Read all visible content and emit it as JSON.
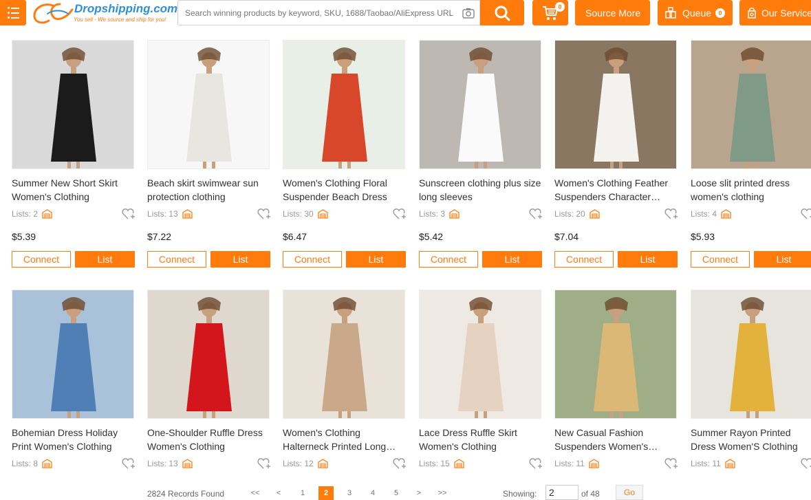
{
  "header": {
    "logo_title": "Dropshipping.com",
    "logo_tagline": "You sell - We source and ship for you!",
    "search_placeholder": "Search winning products by keyword, SKU, 1688/Taobao/AliExpress URL",
    "cart_count": "0",
    "source_more_label": "Source More",
    "queue_label": "Queue",
    "queue_count": "0",
    "our_service_label": "Our Service",
    "accent_color": "#ff7b0c"
  },
  "products": [
    {
      "title": "Summer New Short Skirt Women's Clothing",
      "lists": "Lists: 2",
      "price": "$5.39",
      "connect": "Connect",
      "list": "List",
      "img_bg": "#d9d9d9",
      "dress": "#1b1b1b"
    },
    {
      "title": "Beach skirt swimwear sun protection clothing",
      "lists": "Lists: 13",
      "price": "$7.22",
      "connect": "Connect",
      "list": "List",
      "img_bg": "#f7f7f7",
      "dress": "#e8e6e1"
    },
    {
      "title": "Women's Clothing Floral Suspender Beach Dress",
      "lists": "Lists: 30",
      "price": "$6.47",
      "connect": "Connect",
      "list": "List",
      "img_bg": "#e8efe6",
      "dress": "#d9472b"
    },
    {
      "title": "Sunscreen clothing plus size long sleeves",
      "lists": "Lists: 3",
      "price": "$5.42",
      "connect": "Connect",
      "list": "List",
      "img_bg": "#bdb8b1",
      "dress": "#fafafa"
    },
    {
      "title": "Women's Clothing Feather Suspenders Character Fashion Dress",
      "lists": "Lists: 20",
      "price": "$7.04",
      "connect": "Connect",
      "list": "List",
      "img_bg": "#8a7762",
      "dress": "#f4f2ee"
    },
    {
      "title": "Loose slit printed dress women's clothing",
      "lists": "Lists: 4",
      "price": "$5.93",
      "connect": "Connect",
      "list": "List",
      "img_bg": "#b9a58e",
      "dress": "#7f9a86"
    },
    {
      "title": "Bohemian Dress Holiday Print Women's Clothing",
      "lists": "Lists: 8",
      "price": "",
      "connect": "",
      "list": "",
      "img_bg": "#a9c2d9",
      "dress": "#4f7fb5"
    },
    {
      "title": "One-Shoulder Ruffle Dress Women's Clothing",
      "lists": "Lists: 13",
      "price": "",
      "connect": "",
      "list": "",
      "img_bg": "#dfd8cf",
      "dress": "#d3151c"
    },
    {
      "title": "Women's Clothing Halterneck Printed Long Dress",
      "lists": "Lists: 12",
      "price": "",
      "connect": "",
      "list": "",
      "img_bg": "#e9e2d8",
      "dress": "#c9a98a"
    },
    {
      "title": "Lace Dress Ruffle Skirt Women's Clothing",
      "lists": "Lists: 15",
      "price": "",
      "connect": "",
      "list": "",
      "img_bg": "#efe9e3",
      "dress": "#e6d2c0"
    },
    {
      "title": "New Casual Fashion Suspenders Women's Jumpsuit",
      "lists": "Lists: 11",
      "price": "",
      "connect": "",
      "list": "",
      "img_bg": "#9fae86",
      "dress": "#dcb877"
    },
    {
      "title": "Summer Rayon Printed Dress Women'S Clothing",
      "lists": "Lists: 11",
      "price": "",
      "connect": "",
      "list": "",
      "img_bg": "#e7e4dd",
      "dress": "#e3b23c"
    }
  ],
  "pagination": {
    "records": "2824 Records Found",
    "first": "<<",
    "prev": "<",
    "pages": [
      "1",
      "2",
      "3",
      "4",
      "5"
    ],
    "current": "2",
    "next": ">",
    "last": ">>",
    "showing_label": "Showing:",
    "page_value": "2",
    "of_total": "of 48",
    "go_label": "Go"
  }
}
